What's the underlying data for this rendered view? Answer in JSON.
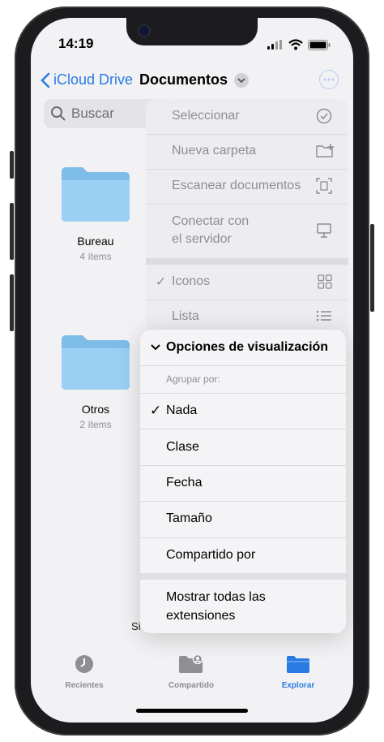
{
  "status": {
    "time": "14:19"
  },
  "nav": {
    "back_label": "iCloud Drive",
    "title": "Documentos"
  },
  "search": {
    "placeholder": "Buscar"
  },
  "folders": [
    {
      "name": "Bureau",
      "count": "4 ítems"
    },
    {
      "name": "Otros",
      "count": "2 ítems"
    }
  ],
  "background_text": "Si",
  "back_menu": {
    "items": [
      {
        "label": "Seleccionar",
        "icon": "checkmark-circle-icon"
      },
      {
        "label": "Nueva carpeta",
        "icon": "folder-plus-icon"
      },
      {
        "label": "Escanear documentos",
        "icon": "scan-document-icon"
      },
      {
        "label_line1": "Conectar con",
        "label_line2": "el servidor",
        "icon": "monitor-icon"
      },
      {
        "label": "Iconos",
        "icon": "grid-icon",
        "checked": true
      },
      {
        "label": "Lista",
        "icon": "list-icon"
      }
    ]
  },
  "view_menu": {
    "header": "Opciones de visualización",
    "group_label": "Agrupar por:",
    "options": [
      "Nada",
      "Clase",
      "Fecha",
      "Tamaño",
      "Compartido por"
    ],
    "selected": "Nada",
    "show_ext_line1": "Mostrar todas las",
    "show_ext_line2": "extensiones"
  },
  "tabs": [
    {
      "label": "Recientes",
      "icon": "clock-icon"
    },
    {
      "label": "Compartido",
      "icon": "shared-folder-icon"
    },
    {
      "label": "Explorar",
      "icon": "folder-icon",
      "active": true
    }
  ],
  "colors": {
    "accent": "#2a7ae4",
    "folder": "#8cc8f2"
  }
}
